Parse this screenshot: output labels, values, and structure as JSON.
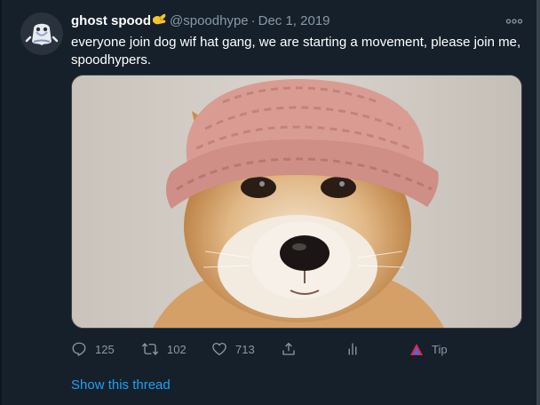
{
  "tweet": {
    "author_name": "ghost spood",
    "author_handle": "@spoodhype",
    "separator": "·",
    "date": "Dec 1, 2019",
    "text": "everyone join dog wif hat gang, we are starting a movement, please join me, spoodhypers.",
    "media_icon": "shiba-dog-in-pink-knit-hat-photo"
  },
  "actions": {
    "reply_count": "125",
    "retweet_count": "102",
    "like_count": "713",
    "tip_label": "Tip"
  },
  "show_thread_label": "Show this thread",
  "icons": {
    "badge": "yellow-hand-emoji",
    "more": "more-dots-icon",
    "reply": "reply-icon",
    "retweet": "retweet-icon",
    "like": "heart-icon",
    "share": "share-icon",
    "analytics": "analytics-icon",
    "tip": "tip-icon"
  },
  "colors": {
    "background": "#15202b",
    "secondary_text": "#8899a6",
    "link": "#1da1f2",
    "border": "#38444d"
  }
}
